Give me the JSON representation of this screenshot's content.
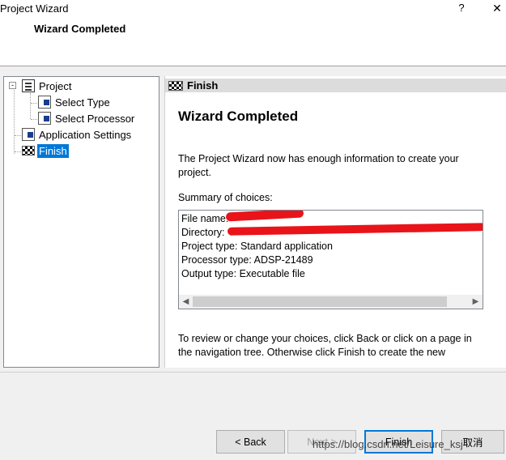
{
  "window": {
    "title": "Project Wizard",
    "help_label": "?",
    "close_label": "✕"
  },
  "header": {
    "title": "Wizard Completed"
  },
  "tree": {
    "items": [
      {
        "label": "Project",
        "icon": "project-icon",
        "expander": "-"
      },
      {
        "label": "Select Type",
        "icon": "check-icon"
      },
      {
        "label": "Select Processor",
        "icon": "check-icon"
      },
      {
        "label": "Application Settings",
        "icon": "check-icon"
      },
      {
        "label": "Finish",
        "icon": "flag-icon",
        "selected": true
      }
    ]
  },
  "panel": {
    "header_label": "Finish",
    "title": "Wizard Completed",
    "intro": "The Project Wizard now has enough information to create your project.",
    "summary_label": "Summary of choices:",
    "summary_lines": [
      "File name:",
      "Directory:",
      "Project type: Standard application",
      "Processor type: ADSP-21489",
      "Output type: Executable file"
    ],
    "footer": "To review or change your choices, click Back or click on a page in the navigation tree.  Otherwise click Finish to create the new"
  },
  "buttons": {
    "back": "< Back",
    "next": "Next >",
    "finish": "Finish",
    "cancel": "取消"
  },
  "watermark": "https://blog.csdn.net/Leisure_ksj",
  "colors": {
    "selection": "#0078d7",
    "redaction": "#e8141a"
  }
}
